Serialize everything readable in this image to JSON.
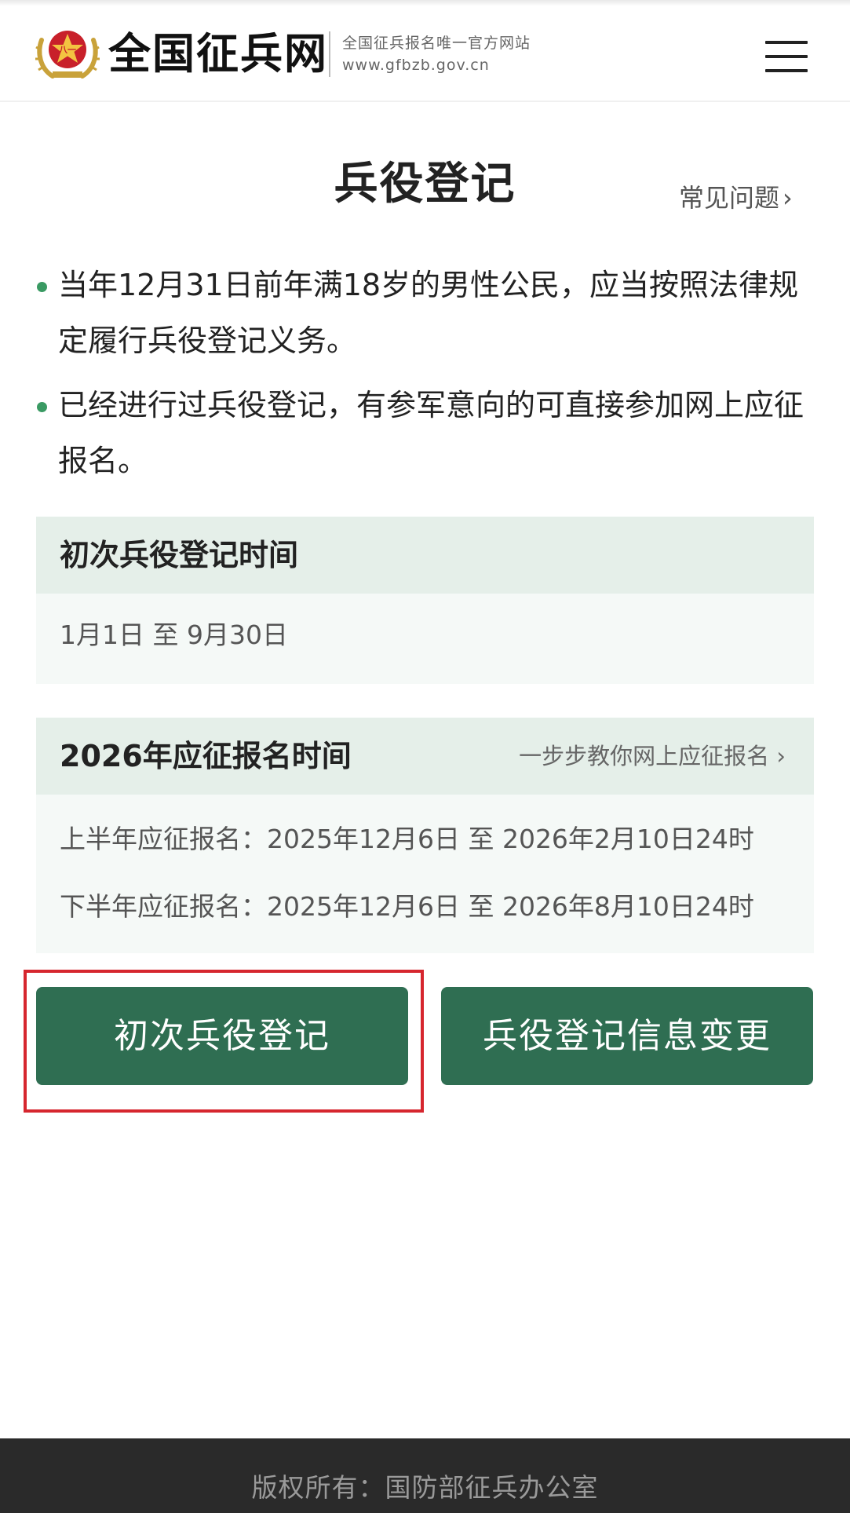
{
  "header": {
    "site_name": "全国征兵网",
    "tagline": "全国征兵报名唯一官方网站",
    "url": "www.gfbzb.gov.cn",
    "logo_icon": "army-emblem-icon",
    "menu_icon": "hamburger-menu-icon"
  },
  "page": {
    "title": "兵役登记",
    "faq_label": "常见问题",
    "faq_icon": "chevron-right-icon"
  },
  "bullets": [
    "当年12月31日前年满18岁的男性公民，应当按照法律规定履行兵役登记义务。",
    "已经进行过兵役登记，有参军意向的可直接参加网上应征报名。"
  ],
  "registration_card": {
    "title": "初次兵役登记时间",
    "period": "1月1日 至 9月30日"
  },
  "enlistment_card": {
    "title": "2026年应征报名时间",
    "guide_link": "一步步教你网上应征报名",
    "guide_icon": "chevron-right-icon",
    "first_half": "上半年应征报名：2025年12月6日 至 2026年2月10日24时",
    "second_half": "下半年应征报名：2025年12月6日 至 2026年8月10日24时"
  },
  "buttons": {
    "initial_registration": "初次兵役登记",
    "info_change": "兵役登记信息变更"
  },
  "footer": {
    "copyright": "版权所有：国防部征兵办公室"
  },
  "colors": {
    "primary_green": "#2f6e52",
    "bullet_green": "#3a9a63",
    "card_header_bg": "#e5efe9",
    "card_body_bg": "#f5f9f7",
    "highlight_red": "#d6262e",
    "footer_bg": "#2a2a2a"
  }
}
